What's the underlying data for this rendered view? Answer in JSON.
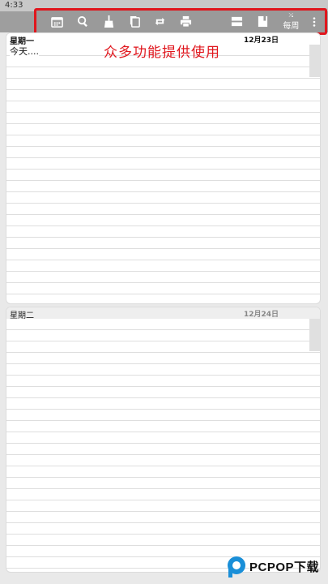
{
  "status_bar": {
    "time": "4:33"
  },
  "toolbar": {
    "buttons": [
      {
        "icon": "calendar-icon"
      },
      {
        "icon": "search-icon"
      },
      {
        "icon": "broom-icon"
      },
      {
        "icon": "copy-icon"
      },
      {
        "icon": "repeat-icon"
      },
      {
        "icon": "print-icon"
      },
      {
        "icon": "moon-icon"
      },
      {
        "icon": "layout-icon"
      },
      {
        "icon": "notebook-icon"
      }
    ],
    "weekly_label": "每周",
    "accent_color": "#e0161d"
  },
  "promo": {
    "text": "众多功能提供使用"
  },
  "days": [
    {
      "name": "星期一",
      "date": "12月23日",
      "note": "今天...."
    },
    {
      "name": "星期二",
      "date": "12月24日",
      "note": ""
    }
  ],
  "watermark": {
    "brand": "PCPOP下载"
  }
}
